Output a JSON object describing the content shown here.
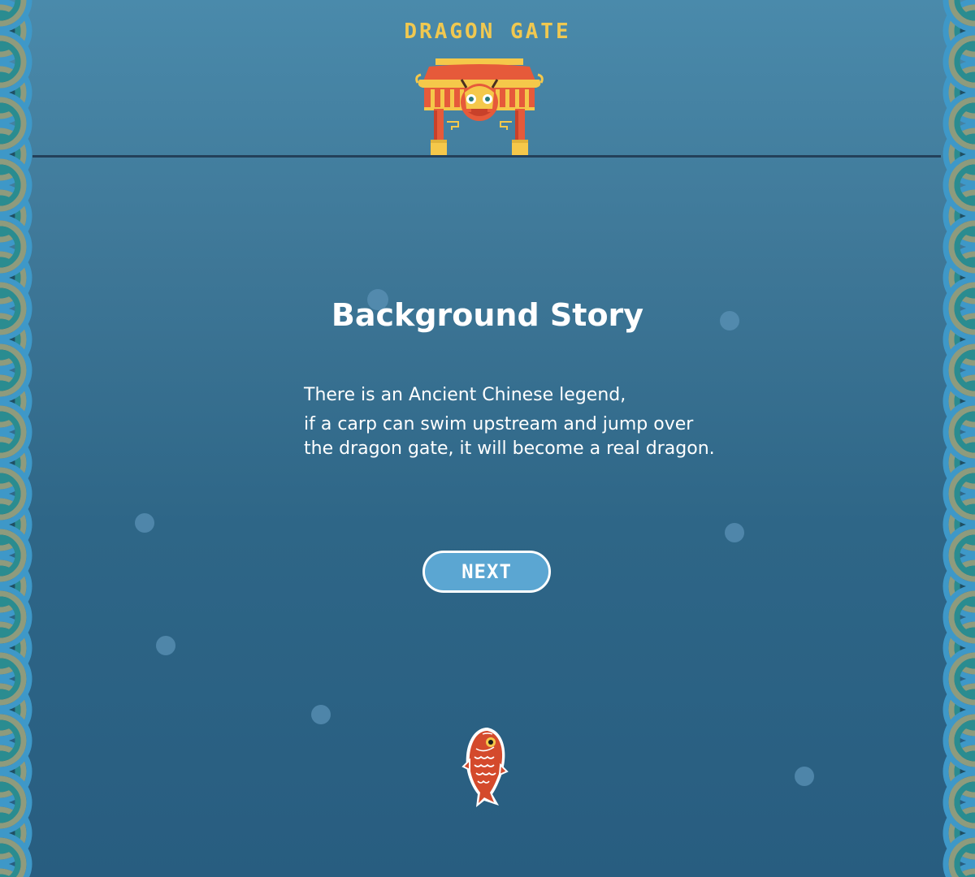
{
  "game": {
    "title": "DRAGON GATE"
  },
  "story_screen": {
    "heading": "Background Story",
    "lines": [
      "There is an Ancient Chinese legend,",
      "if a carp can swim upstream and jump over",
      "the dragon gate, it will become a real dragon."
    ],
    "next_label": "NEXT"
  },
  "colors": {
    "background_top": "#4a8aab",
    "background_bottom": "#285d80",
    "title_gold": "#f0c850",
    "button_fill": "#5ba6d2",
    "gate_red": "#e65a3a",
    "carp_red": "#d44a2c"
  },
  "icons": {
    "gate": "dragon-gate-icon",
    "player": "carp-fish-icon",
    "border": "wave-pattern"
  }
}
